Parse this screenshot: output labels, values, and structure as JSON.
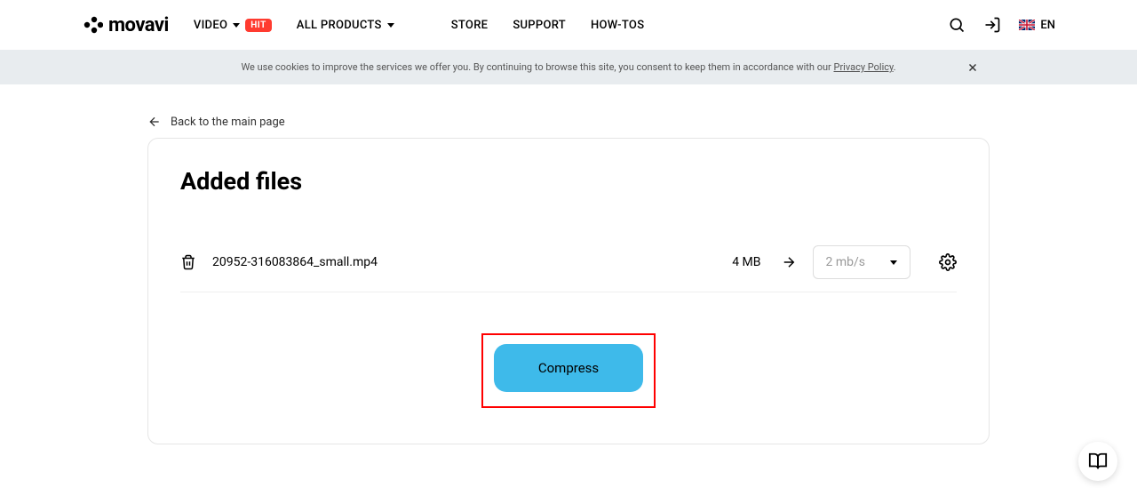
{
  "header": {
    "brand": "movavi",
    "nav": {
      "video": "VIDEO",
      "hit_badge": "HIT",
      "all_products": "ALL PRODUCTS",
      "store": "STORE",
      "support": "SUPPORT",
      "howtos": "HOW-TOS"
    },
    "lang": "EN"
  },
  "cookie": {
    "text_before": "We use cookies to improve the services we offer you. By continuing to browse this site, you consent to keep them in accordance with our ",
    "link": "Privacy Policy",
    "text_after": "."
  },
  "back_link": "Back to the main page",
  "card": {
    "title": "Added files",
    "file": {
      "name": "20952-316083864_small.mp4",
      "size": "4 MB",
      "rate_selected": "2 mb/s"
    },
    "compress_label": "Compress"
  }
}
